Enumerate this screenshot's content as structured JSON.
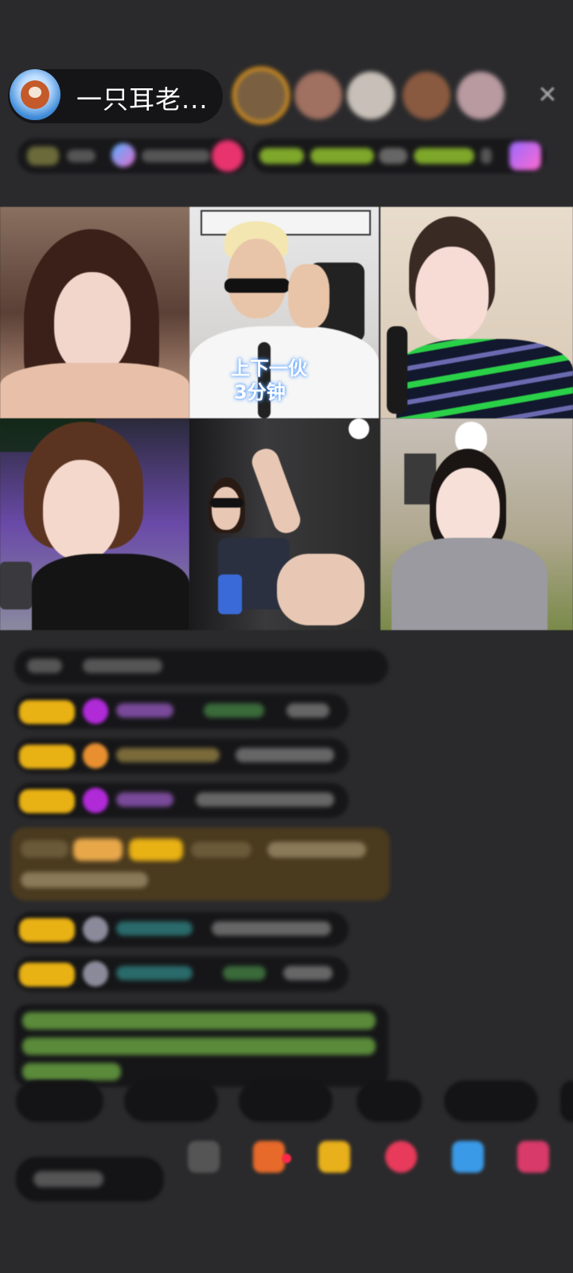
{
  "header": {
    "host_name": "一只耳老...",
    "close_icon": "close-icon"
  },
  "stream": {
    "subtitle_line1": "上下一伙",
    "subtitle_line2": "3分钟"
  },
  "chat": {
    "messages_count_visible": 9
  },
  "colors": {
    "background": "#2a2a2c",
    "badge": "#e8b114",
    "pill": "#141416"
  }
}
